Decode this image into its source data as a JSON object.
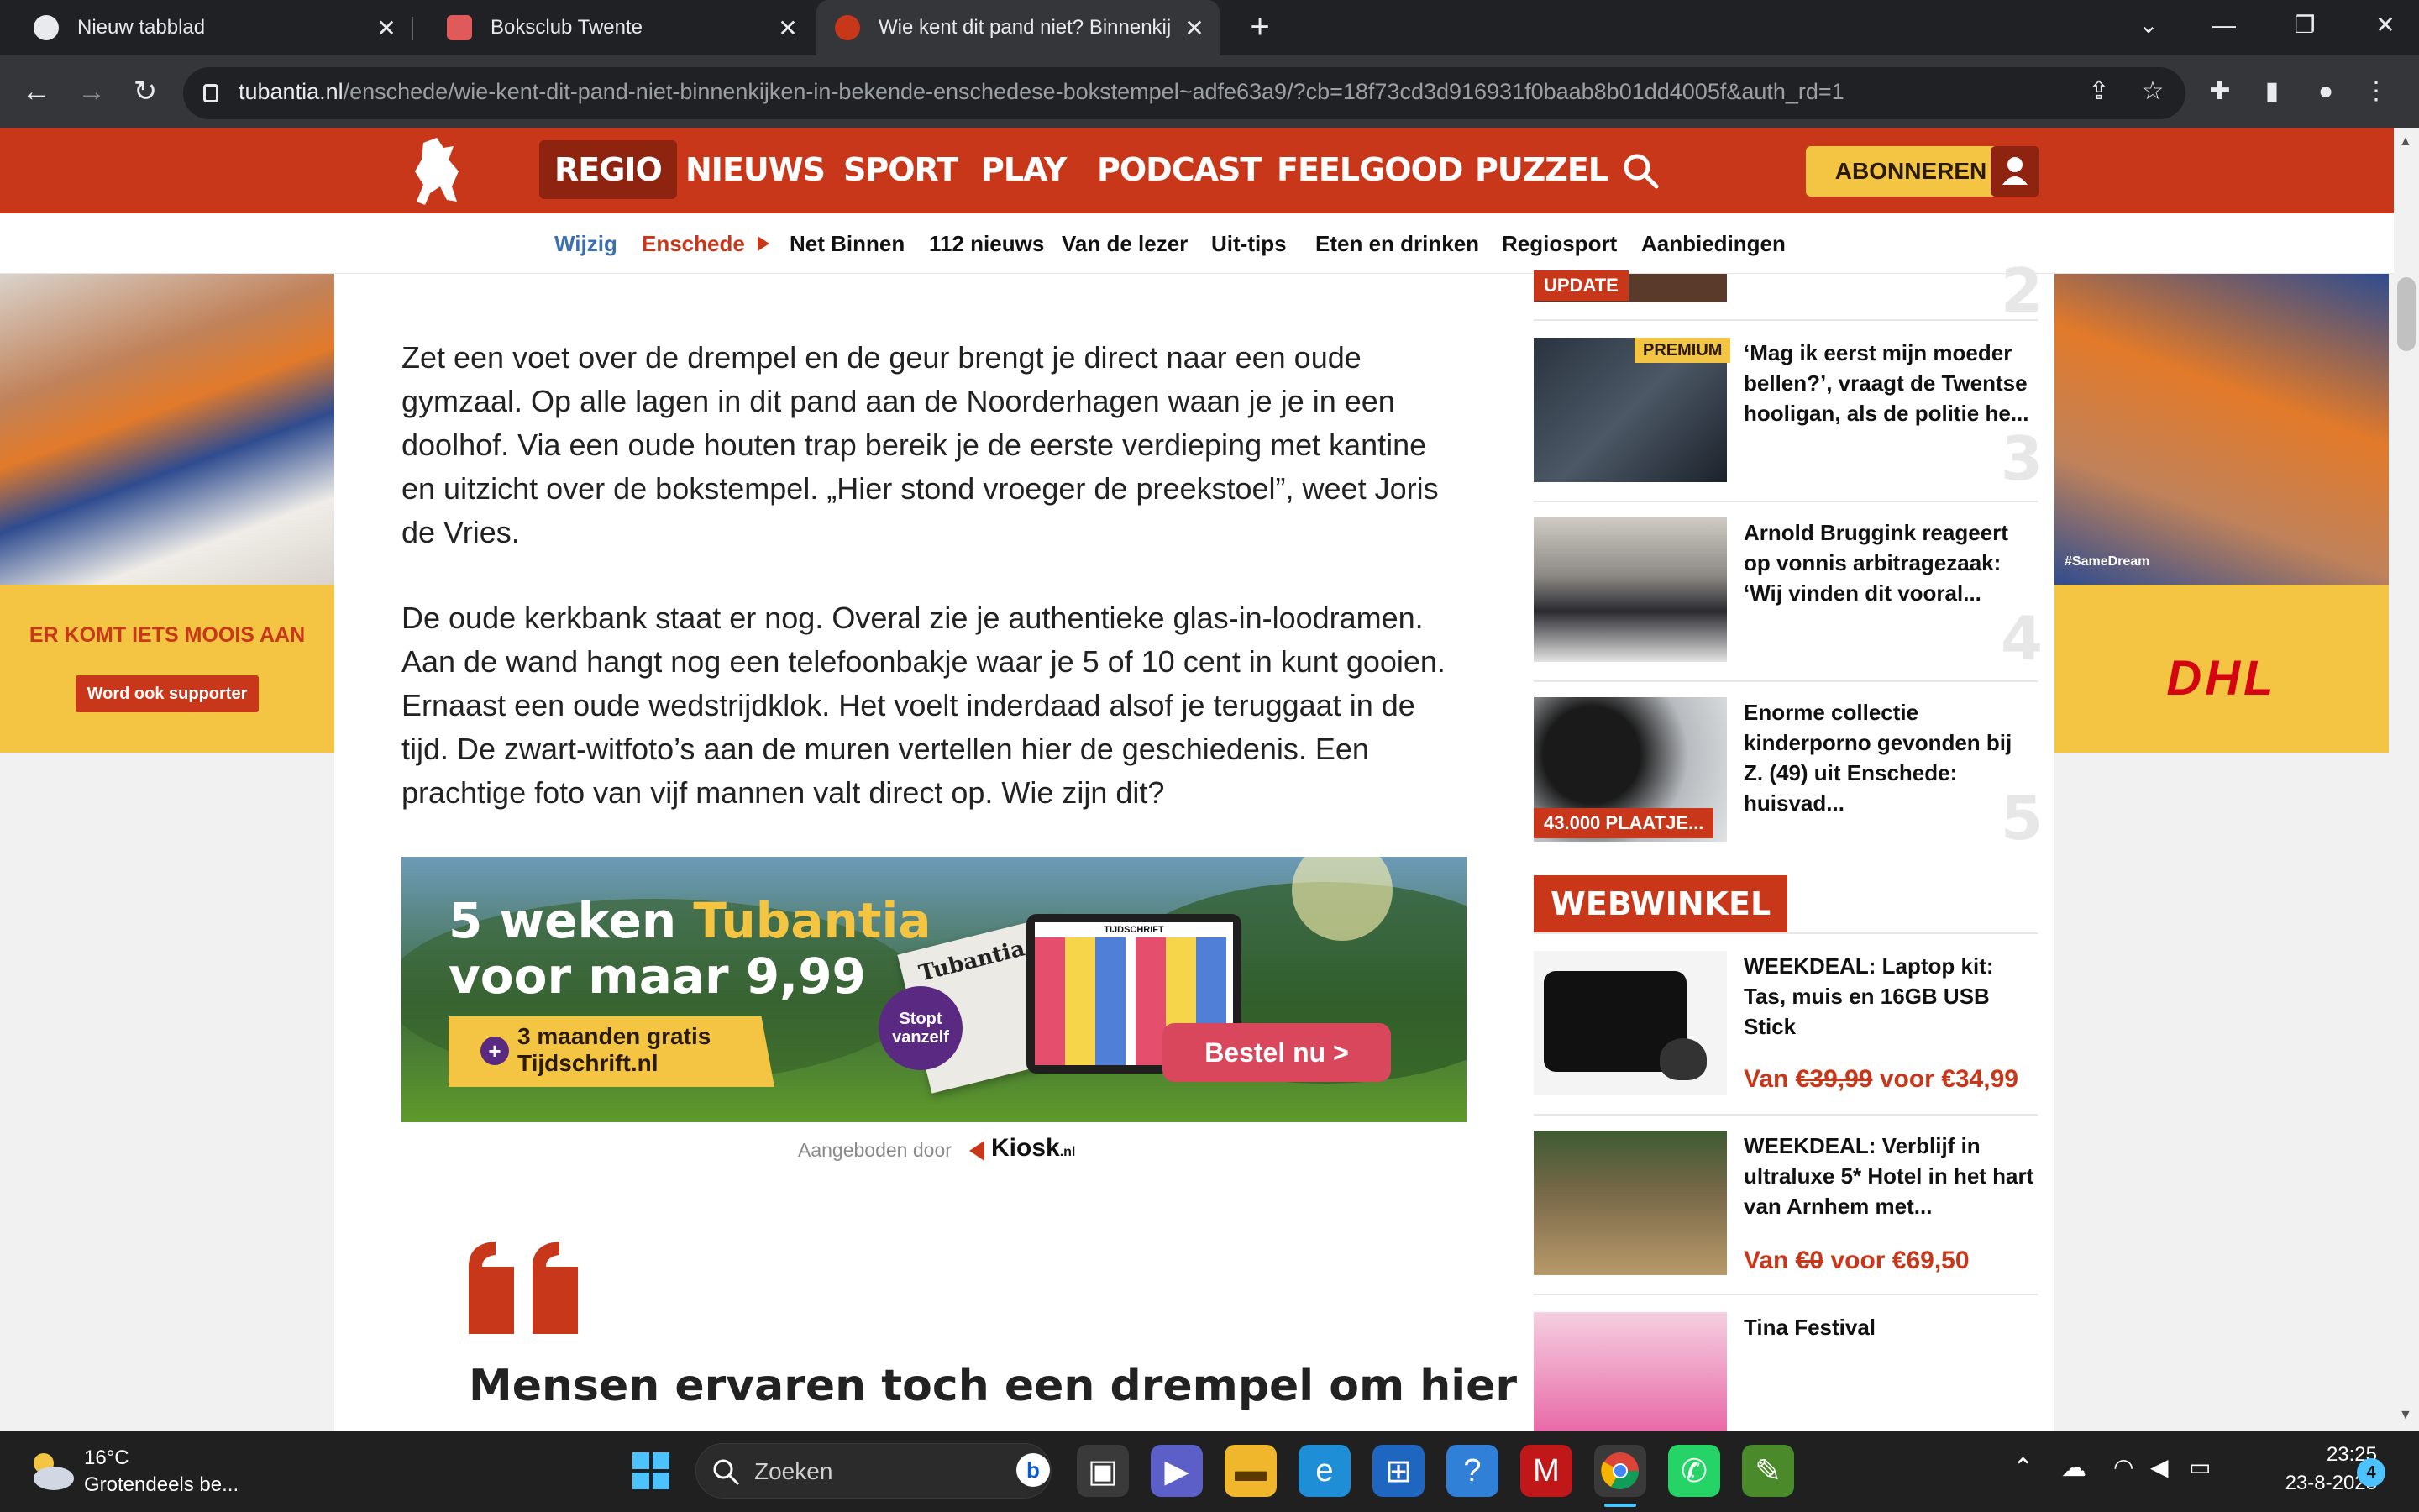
{
  "browser": {
    "tabs": [
      {
        "title": "Nieuw tabblad",
        "favicon_color": "#e8eaed",
        "active": false
      },
      {
        "title": "Boksclub Twente",
        "favicon_color": "#e05a5a",
        "active": false
      },
      {
        "title": "Wie kent dit pand niet? Binnenkij",
        "favicon_color": "#c8371a",
        "active": true
      }
    ],
    "url_domain": "tubantia.nl",
    "url_path": "/enschede/wie-kent-dit-pand-niet-binnenkijken-in-bekende-enschedese-bokstempel~adfe63a9/?cb=18f73cd3d916931f0baab8b01dd4005f&auth_rd=1"
  },
  "site": {
    "brand_color": "#c8371a",
    "nav": [
      "REGIO",
      "NIEUWS",
      "SPORT",
      "PLAY",
      "PODCAST",
      "FEELGOOD",
      "PUZZEL"
    ],
    "abonneren_label": "ABONNEREN",
    "subnav": {
      "wijzig": "Wijzig",
      "current": "Enschede",
      "items": [
        "Net Binnen",
        "112 nieuws",
        "Van de lezer",
        "Uit-tips",
        "Eten en drinken",
        "Regiosport",
        "Aanbiedingen"
      ]
    }
  },
  "left_ad": {
    "title": "ER KOMT IETS MOOIS AAN",
    "button": "Word ook supporter"
  },
  "right_ad": {
    "logo_text": "DHL",
    "hashtag": "#SameDream"
  },
  "article": {
    "paragraphs": [
      "Zet een voet over de drempel en de geur brengt je direct naar een oude gymzaal. Op alle lagen in dit pand aan de Noorderhagen waan je je in een doolhof. Via een oude houten trap bereik je de eerste verdieping met kantine en uitzicht over de bokstempel. „Hier stond vroeger de preekstoel”, weet Joris de Vries.",
      "De oude kerkbank staat er nog. Overal zie je authentieke glas-in-loodramen. Aan de wand hangt nog een telefoonbakje waar je 5 of 10 cent in kunt gooien. Ernaast een oude wedstrijdklok. Het voelt inderdaad alsof je teruggaat in de tijd. De zwart-witfoto’s aan de muren vertellen hier de geschiedenis. Een prachtige foto van vijf mannen valt direct op. Wie zijn dit?"
    ],
    "quote_headline": "Mensen ervaren toch een drempel om hier"
  },
  "banner_ad": {
    "line1_a": "5 weken ",
    "line1_b": "Tubantia",
    "line2": "voor maar 9,99",
    "promo": "3 maanden gratis Tijdschrift.nl",
    "stop": "Stopt vanzelf",
    "cta": "Bestel nu >",
    "paper_label": "Tubantia",
    "tablet_label": "TIJDSCHRIFT",
    "offered_by": "Aangeboden door",
    "kiosk": "Kiosk",
    "kiosk_suffix": ".nl"
  },
  "sidebar": {
    "top_badge": "UPDATE",
    "top_rank": "2",
    "items": [
      {
        "title": "‘Mag ik eerst mijn moeder bellen?’, vraagt de Twentse hooligan, als de politie he...",
        "rank": "3",
        "badge": "PREMIUM"
      },
      {
        "title": "Arnold Bruggink reageert op vonnis arbitragezaak: ‘Wij vinden dit vooral...",
        "rank": "4",
        "badge": ""
      },
      {
        "title": "Enorme collectie kinderporno gevonden bij Z. (49) uit Enschede: huisvad...",
        "rank": "5",
        "badge": "43.000 PLAATJE..."
      }
    ],
    "webwinkel_title": "WEBWINKEL",
    "shop": [
      {
        "title": "WEEKDEAL: Laptop kit: Tas, muis en 16GB USB Stick",
        "van": "Van",
        "old": "€39,99",
        "voor": "voor",
        "new": "€34,99"
      },
      {
        "title": "WEEKDEAL: Verblijf in ultraluxe 5* Hotel in het hart van Arnhem met...",
        "van": "Van",
        "old": "€0",
        "voor": "voor",
        "new": "€69,50"
      },
      {
        "title": "Tina Festival"
      }
    ]
  },
  "taskbar": {
    "weather_temp": "16°C",
    "weather_desc": "Grotendeels be...",
    "search_placeholder": "Zoeken",
    "time": "23:25",
    "date": "23-8-2023",
    "notification_count": "4"
  }
}
